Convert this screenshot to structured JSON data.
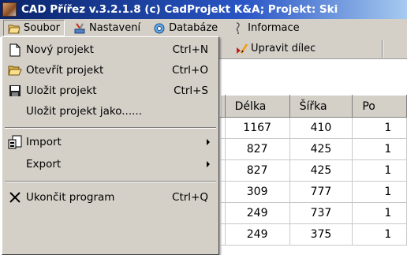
{
  "window": {
    "title": "CAD Přířez v.3.2.1.8  (c) CadProjekt K&A; Projekt: Ski"
  },
  "menubar": {
    "items": [
      {
        "label": "Soubor",
        "icon": "open-folder-icon"
      },
      {
        "label": "Nastavení",
        "icon": "settings-tools-icon"
      },
      {
        "label": "Databáze",
        "icon": "database-icon"
      },
      {
        "label": "Informace",
        "icon": "info-icon"
      }
    ]
  },
  "toolbar": {
    "edit_label": "Upravit dílec"
  },
  "table": {
    "columns": [
      "Délka",
      "Šířka",
      "Po"
    ],
    "rows": [
      [
        "1167",
        "410",
        "1"
      ],
      [
        "827",
        "425",
        "1"
      ],
      [
        "827",
        "425",
        "1"
      ],
      [
        "309",
        "777",
        "1"
      ],
      [
        "249",
        "737",
        "1"
      ],
      [
        "249",
        "375",
        "1"
      ]
    ]
  },
  "file_menu": {
    "items": [
      {
        "label": "Nový projekt",
        "shortcut": "Ctrl+N",
        "icon": "new-file-icon"
      },
      {
        "label": "Otevřít projekt",
        "shortcut": "Ctrl+O",
        "icon": "open-folder-icon"
      },
      {
        "label": "Uložit projekt",
        "shortcut": "Ctrl+S",
        "icon": "save-disk-icon"
      },
      {
        "label": "Uložit projekt jako......",
        "shortcut": ""
      },
      {
        "label": "Import",
        "icon": "import-icon",
        "submenu": true
      },
      {
        "label": "Export",
        "submenu": true
      },
      {
        "label": "Ukončit program",
        "shortcut": "Ctrl+Q",
        "icon": "exit-x-icon"
      }
    ]
  }
}
